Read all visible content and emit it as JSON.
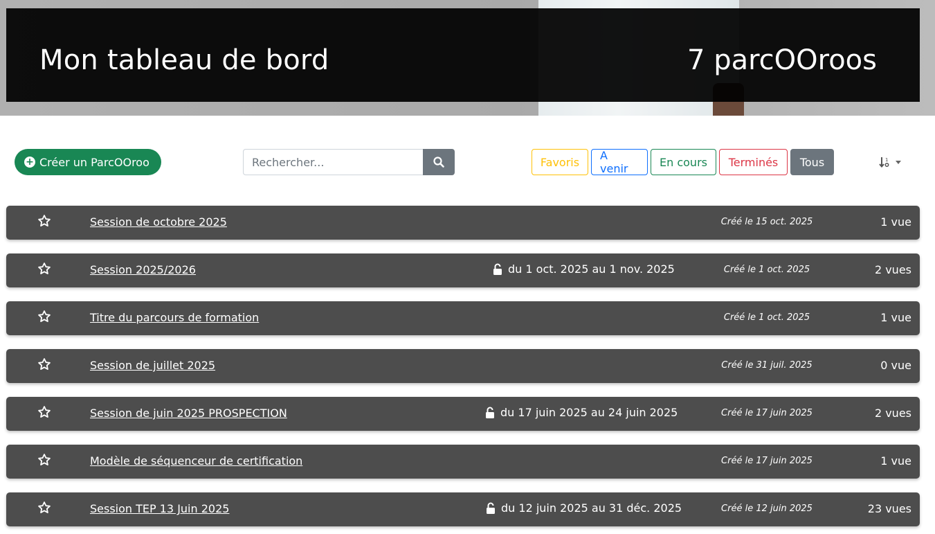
{
  "header": {
    "title": "Mon tableau de bord",
    "count_label": "7 parcOOroos"
  },
  "toolbar": {
    "create_label": "Créer un ParcOOroo",
    "search_placeholder": "Rechercher...",
    "filters": [
      {
        "label": "Favoris",
        "color": "#ffc107"
      },
      {
        "label": "A venir",
        "color": "#0d6efd"
      },
      {
        "label": "En cours",
        "color": "#198754"
      },
      {
        "label": "Terminés",
        "color": "#dc3545"
      },
      {
        "label": "Tous",
        "color": "#6c757d",
        "active": true
      }
    ]
  },
  "rows": [
    {
      "name": "Session de octobre 2025",
      "dates": "",
      "created": "Créé le 15 oct. 2025",
      "views": "1 vue"
    },
    {
      "name": "Session 2025/2026",
      "dates": "du 1 oct. 2025 au 1 nov. 2025",
      "created": "Créé le 1 oct. 2025",
      "views": "2 vues"
    },
    {
      "name": "Titre du parcours de formation",
      "dates": "",
      "created": "Créé le 1 oct. 2025",
      "views": "1 vue"
    },
    {
      "name": "Session de juillet 2025",
      "dates": "",
      "created": "Créé le 31 juil. 2025",
      "views": "0 vue"
    },
    {
      "name": "Session de juin 2025 PROSPECTION",
      "dates": "du 17 juin 2025 au 24 juin 2025",
      "created": "Créé le 17 juin 2025",
      "views": "2 vues"
    },
    {
      "name": "Modèle de séquenceur de certification",
      "dates": "",
      "created": "Créé le 17 juin 2025",
      "views": "1 vue"
    },
    {
      "name": "Session TEP 13 Juin 2025",
      "dates": "du 12 juin 2025 au 31 déc. 2025",
      "created": "Créé le 12 juin 2025",
      "views": "23 vues"
    }
  ],
  "icons": {
    "star": "star-outline-icon",
    "lock": "unlock-icon",
    "search": "search-icon",
    "sort": "sort-icon",
    "plus": "plus-circle-icon"
  },
  "colors": {
    "row_bg": "#4d4d4d",
    "create_btn": "#198754",
    "banner_panel": "#0a0a0a"
  }
}
